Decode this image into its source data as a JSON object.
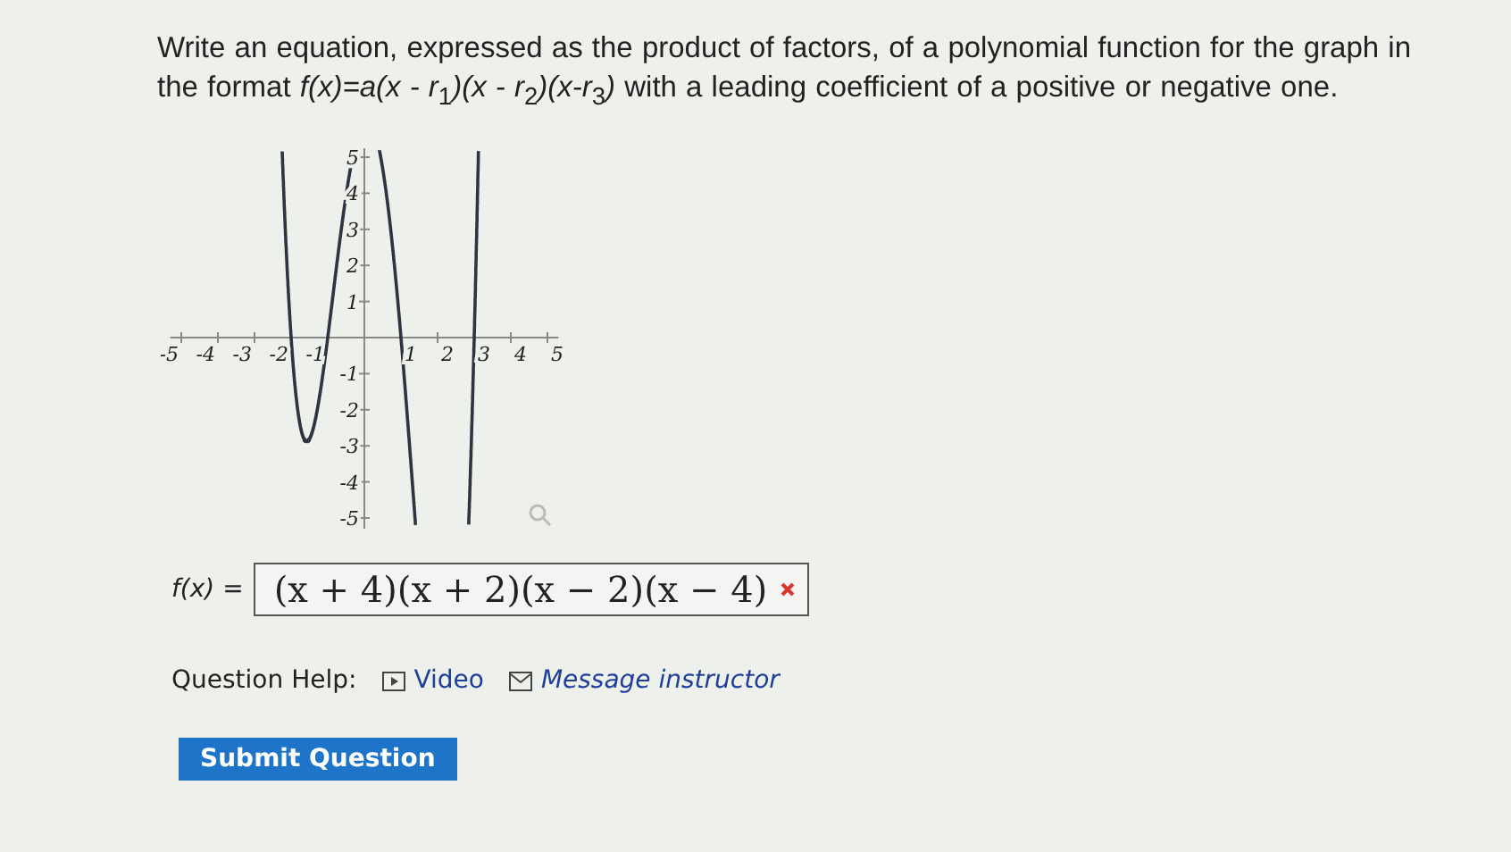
{
  "question": {
    "text": "Write an equation, expressed as the product of factors, of a polynomial function for the graph in the format  *f(x)=a(x - r*$_{1}$*)(x - r*$_{2}$*)(x-r*$_{3}$*)* with a leading coefficient of a  positive or negative one."
  },
  "graph": {
    "x_ticks": [
      "-5",
      "-4",
      "-3",
      "-2",
      "-1",
      "1",
      "2",
      "3",
      "4",
      "5"
    ],
    "y_ticks": [
      "5",
      "4",
      "3",
      "2",
      "1",
      "-1",
      "-2",
      "-3",
      "-4",
      "-5"
    ]
  },
  "answer": {
    "label": "f(x) =",
    "value": "(x + 4)(x + 2)(x − 2)(x − 4)",
    "correct": false
  },
  "help": {
    "label": "Question Help:",
    "links": [
      {
        "kind": "video",
        "label": "Video"
      },
      {
        "kind": "message",
        "label": "Message instructor"
      }
    ]
  },
  "submit": {
    "label": "Submit Question"
  }
}
